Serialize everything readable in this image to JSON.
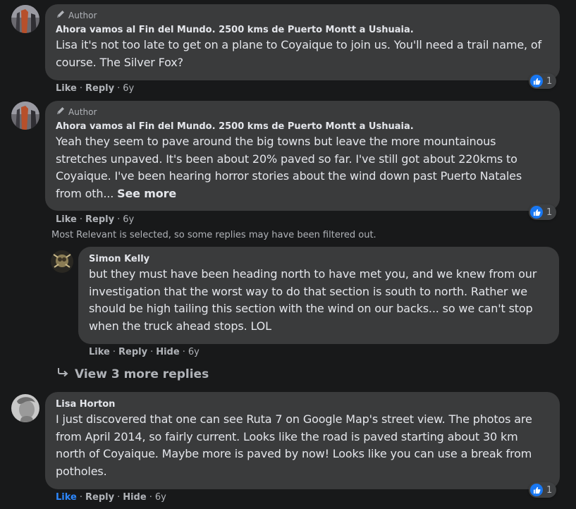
{
  "comments": [
    {
      "author_tag": "Author",
      "name": "Ahora vamos al Fin del Mundo. 2500 kms de Puerto Montt a Ushuaia.",
      "text": "Lisa it's not too late to get on a plane to Coyaique to join us. You'll need a trail name, of course. The Silver Fox?",
      "like": "Like",
      "reply": "Reply",
      "time": "6y",
      "reaction_count": "1"
    },
    {
      "author_tag": "Author",
      "name": "Ahora vamos al Fin del Mundo. 2500 kms de Puerto Montt a Ushuaia.",
      "text": "Yeah they seem to pave around the big towns but leave the more mountainous stretches unpaved. It's been about 20% paved so far. I've still got about 220kms to Coyaique. I've been hearing horror stories about the wind down past Puerto Natales from oth...",
      "see_more": "See more",
      "like": "Like",
      "reply": "Reply",
      "time": "6y",
      "reaction_count": "1"
    }
  ],
  "filter_note": "Most Relevant is selected, so some replies may have been filtered out.",
  "reply": {
    "name": "Simon Kelly",
    "text": "but they must have been heading north to have met you, and we knew from our investigation that the worst way to do that section is south to north. Rather we should be high tailing this section with the wind on our backs... so we can't stop when the truck ahead stops. LOL",
    "like": "Like",
    "reply": "Reply",
    "hide": "Hide",
    "time": "6y"
  },
  "view_more": "View 3 more replies",
  "comment3": {
    "name": "Lisa Horton",
    "text": "I just discovered that one can see Ruta 7 on Google Map's street view. The photos are from April 2014, so fairly current. Looks like the road is paved starting about 30 km north of Coyaique. Maybe more is paved by now! Looks like you can use a break from potholes.",
    "like": "Like",
    "reply": "Reply",
    "hide": "Hide",
    "time": "6y",
    "reaction_count": "1"
  },
  "colors": {
    "background": "#18191a",
    "bubble": "#3a3b3c",
    "text": "#e4e6eb",
    "secondary": "#b0b3b8",
    "like_blue": "#2d88ff",
    "reaction_blue": "#1877f2"
  },
  "icons": {
    "author": "pencil-icon",
    "reaction": "thumbs-up-icon",
    "view_more": "reply-arrow-icon"
  }
}
